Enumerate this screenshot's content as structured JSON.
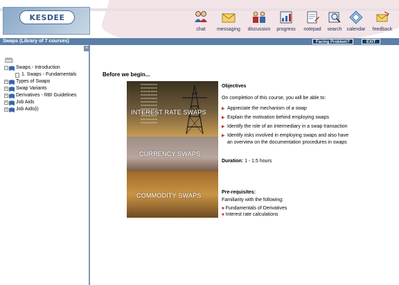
{
  "app": {
    "logo_text": "KESDEE",
    "title": "Swaps (Library of 7 courses)"
  },
  "toolbar": {
    "items": [
      {
        "label": "chat",
        "icon": "chat-icon"
      },
      {
        "label": "messaging",
        "icon": "envelope-icon"
      },
      {
        "label": "discussion",
        "icon": "discussion-icon"
      },
      {
        "label": "progress",
        "icon": "progress-icon"
      },
      {
        "label": "notepad",
        "icon": "notepad-icon"
      },
      {
        "label": "search",
        "icon": "search-icon"
      },
      {
        "label": "calendar",
        "icon": "calendar-icon"
      },
      {
        "label": "feedback",
        "icon": "feedback-icon"
      }
    ]
  },
  "titlebar": {
    "facing_problem": "Facing Problem?",
    "exit": "EXIT"
  },
  "sidebar": {
    "collapse": "×",
    "tree": [
      {
        "label": "Swaps - Introduction",
        "expander": "−"
      },
      {
        "label": "1. Swaps - Fundamentals",
        "expander": ""
      },
      {
        "label": "Types of Swaps",
        "expander": "+"
      },
      {
        "label": "Swap Variants",
        "expander": "+"
      },
      {
        "label": "Derivatives - RBI Guidelines",
        "expander": "+"
      },
      {
        "label": "Job Aids",
        "expander": "+"
      },
      {
        "label": "Job Aids(i)",
        "expander": "+"
      }
    ]
  },
  "content": {
    "heading": "Before we begin...",
    "collage": {
      "label1": "INTEREST RATE SWAPS",
      "label2": "CURRENCY SWAPS",
      "label3": "COMMODITY SWAPS"
    },
    "objectives": {
      "title": "Objectives",
      "intro": "On completion of this course, you will be able to:",
      "items": [
        "Appreciate the mechanism of a swap",
        "Explain the motivation behind employing swaps",
        "Identify the role of an intermediary in a swap transaction",
        "Identify risks involved in employing swaps and also have an overview on the documentation procedures in swaps"
      ]
    },
    "duration": {
      "label": "Duration:",
      "value": "1 - 1.5 hours"
    },
    "prerequisites": {
      "title": "Pre-requisites:",
      "intro": "Familiarity with the following:",
      "items": [
        "Fundamentals of Derivatives",
        "Interest rate calculations"
      ]
    }
  },
  "colors": {
    "titlebar": "#5b7fa6",
    "button": "#1f3d66",
    "bullet": "#c0392b"
  }
}
